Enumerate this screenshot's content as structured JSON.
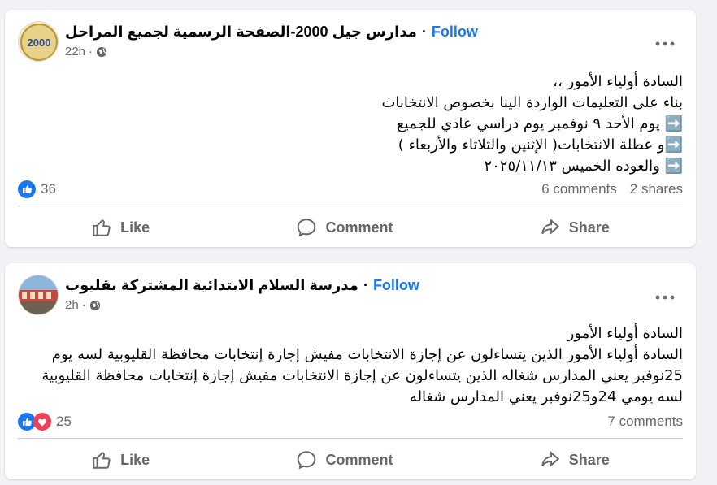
{
  "posts": [
    {
      "page_name": "مدارس جيل 2000-الصفحة الرسمية لجميع المراحل",
      "follow_label": "Follow",
      "time": "22h",
      "lines": [
        "السادة أولياء الأمور ،،",
        "بناء على التعليمات الواردة الينا بخصوص الانتخابات",
        "➡️ يوم الأحد ٩ نوفمبر يوم دراسي عادي للجميع",
        "➡️و عطلة الانتخابات( الإثنين والثلاثاء والأربعاء )",
        "➡️ والعوده الخميس ٢٠٢٥/١١/١٣"
      ],
      "reaction_count": "36",
      "comments": "6 comments",
      "shares": "2 shares"
    },
    {
      "page_name": "مدرسة السلام الابتدائية المشتركة بقليوب",
      "follow_label": "Follow",
      "time": "2h",
      "lines": [
        "السادة أولياء الأمور",
        "السادة أولياء الأمور الذين يتساءلون عن إجازة الانتخابات مفيش إجازة إنتخابات محافظة القليوبية لسه يوم",
        "25نوفبر يعني المدارس شغاله الذين يتساءلون عن إجازة الانتخابات مفيش إجازة إنتخابات محافظة القليوبية",
        "لسه يومي 24و25نوفبر يعني المدارس شغاله"
      ],
      "reaction_count": "25",
      "comments": "7 comments"
    }
  ],
  "actions": {
    "like": "Like",
    "comment": "Comment",
    "share": "Share"
  },
  "colors": {
    "link_blue": "#1877f2",
    "like_blue": "#1877f2",
    "love_red": "#f33e58",
    "meta_gray": "#65676b"
  },
  "icons": [
    "globe-icon",
    "more-icon",
    "like-icon",
    "comment-icon",
    "share-icon",
    "like-reaction-icon",
    "love-reaction-icon"
  ]
}
